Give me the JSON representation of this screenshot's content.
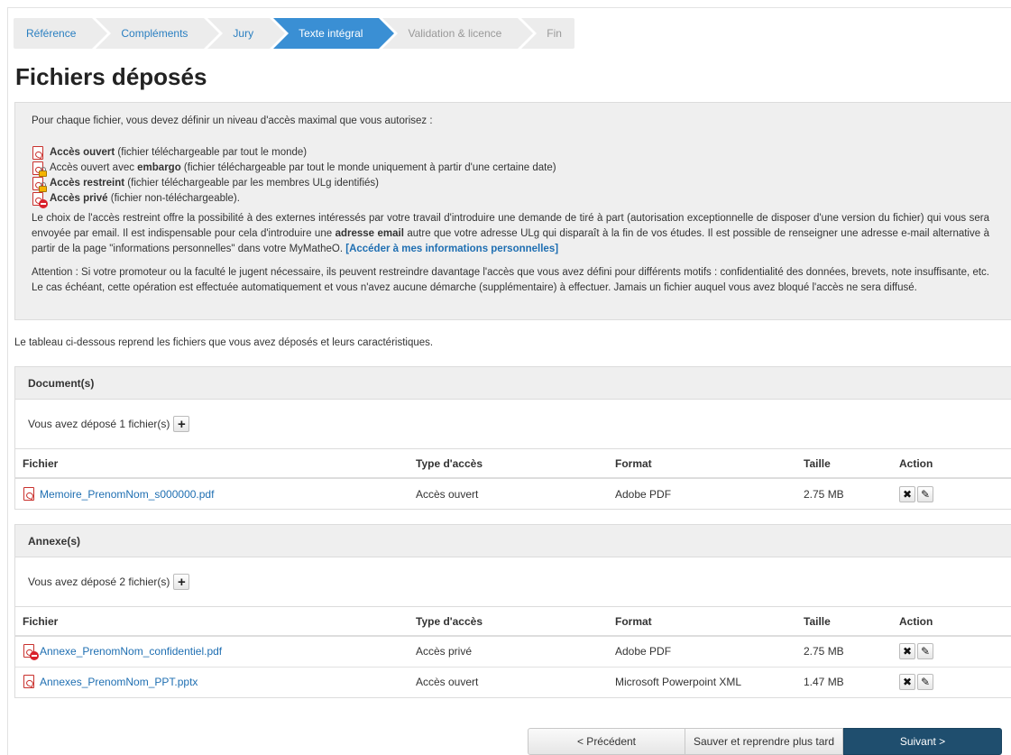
{
  "steps": [
    {
      "label": "Référence"
    },
    {
      "label": "Compléments"
    },
    {
      "label": "Jury"
    },
    {
      "label": "Texte intégral"
    },
    {
      "label": "Validation & licence"
    },
    {
      "label": "Fin"
    }
  ],
  "page_title": "Fichiers déposés",
  "info": {
    "intro": "Pour chaque fichier, vous devez définir un niveau d'accès maximal que vous autorisez :",
    "access_levels": [
      {
        "icon": "pdf-icon",
        "bold": "Accès ouvert",
        "pre": "",
        "rest": " (fichier téléchargeable par tout le monde)"
      },
      {
        "icon": "pdf-lock-icon",
        "pre": "Accès ouvert avec ",
        "bold": "embargo",
        "rest": " (fichier téléchargeable par tout le monde uniquement à partir d'une certaine date)"
      },
      {
        "icon": "pdf-lock-icon",
        "bold": "Accès restreint",
        "pre": "",
        "rest": " (fichier téléchargeable par les membres ULg identifiés)"
      },
      {
        "icon": "pdf-noentry-icon",
        "bold": "Accès privé",
        "pre": "",
        "rest": " (fichier non-téléchargeable)."
      }
    ],
    "para1_a": "Le choix de l'accès restreint offre la possibilité à des externes intéressés par votre travail d'introduire une demande de tiré à part (autorisation exceptionnelle de disposer d'une version du fichier) qui vous sera envoyée par email. Il est indispensable pour cela d'introduire une ",
    "para1_bold": "adresse email",
    "para1_b": " autre que votre adresse ULg qui disparaît à la fin de vos études. Il est possible de renseigner une adresse e-mail alternative à partir de la page \"informations personnelles\" dans votre MyMatheO. ",
    "para1_link": "[Accéder à mes informations personnelles]",
    "para2": "Attention : Si votre promoteur ou la faculté le jugent nécessaire, ils peuvent restreindre davantage l'accès que vous avez défini pour différents motifs : confidentialité des données, brevets, note insuffisante, etc. Le cas échéant, cette opération est effectuée automatiquement et vous n'avez aucune démarche (supplémentaire) à effectuer. Jamais un fichier auquel vous avez bloqué l'accès ne sera diffusé."
  },
  "table_intro": "Le tableau ci-dessous reprend les fichiers que vous avez déposés et leurs caractéristiques.",
  "columns": {
    "file": "Fichier",
    "access": "Type d'accès",
    "format": "Format",
    "size": "Taille",
    "action": "Action"
  },
  "documents": {
    "title": "Document(s)",
    "count_text": "Vous avez déposé 1 fichier(s)",
    "rows": [
      {
        "icon": "pdf-icon",
        "name": "Memoire_PrenomNom_s000000.pdf",
        "access": "Accès ouvert",
        "format": "Adobe PDF",
        "size": "2.75 MB"
      }
    ]
  },
  "annexes": {
    "title": "Annexe(s)",
    "count_text": "Vous avez déposé 2 fichier(s)",
    "rows": [
      {
        "icon": "pdf-noentry-icon",
        "name": "Annexe_PrenomNom_confidentiel.pdf",
        "access": "Accès privé",
        "format": "Adobe PDF",
        "size": "2.75 MB"
      },
      {
        "icon": "pdf-icon",
        "name": "Annexes_PrenomNom_PPT.pptx",
        "access": "Accès ouvert",
        "format": "Microsoft Powerpoint XML",
        "size": "1.47 MB"
      }
    ]
  },
  "footer": {
    "prev": "< Précédent",
    "save": "Sauver et reprendre plus tard",
    "next": "Suivant >"
  },
  "colors": {
    "active_step": "#3a8fd4",
    "link": "#1f6fb2",
    "next_button": "#1f4e6e",
    "pdf_red": "#c9302c"
  }
}
